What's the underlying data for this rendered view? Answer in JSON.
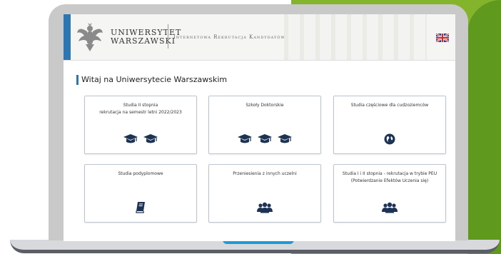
{
  "header": {
    "university_line1": "UNIWERSYTET",
    "university_line2": "WARSZAWSKI",
    "subtitle": "Internetowa Rekrutacja Kandydatów",
    "language_flag": "uk-flag-icon"
  },
  "welcome_title": "Witaj na Uniwersytecie Warszawskim",
  "cards": [
    {
      "label": "Studia II stopnia\nrekrutacja na semestr letni 2022/2023",
      "icon": "graduation-cap-icon",
      "icon_count": 2
    },
    {
      "label": "Szkoły Doktorskie",
      "icon": "graduation-cap-icon",
      "icon_count": 3
    },
    {
      "label": "Studia częściowe dla cudzoziemców",
      "icon": "globe-icon",
      "icon_count": 1
    },
    {
      "label": "Studia podyplomowe",
      "icon": "book-icon",
      "icon_count": 1
    },
    {
      "label": "Przeniesienia z innych uczelni",
      "icon": "users-icon",
      "icon_count": 1
    },
    {
      "label": "Studia I i II stopnia - rekrutacja w trybie PEU (Potwierdzanie Efektów Uczenia się)",
      "icon": "users-icon",
      "icon_count": 1
    }
  ],
  "colors": {
    "accent": "#2b77b5",
    "icon": "#1d3354",
    "green": "#83b42c"
  }
}
